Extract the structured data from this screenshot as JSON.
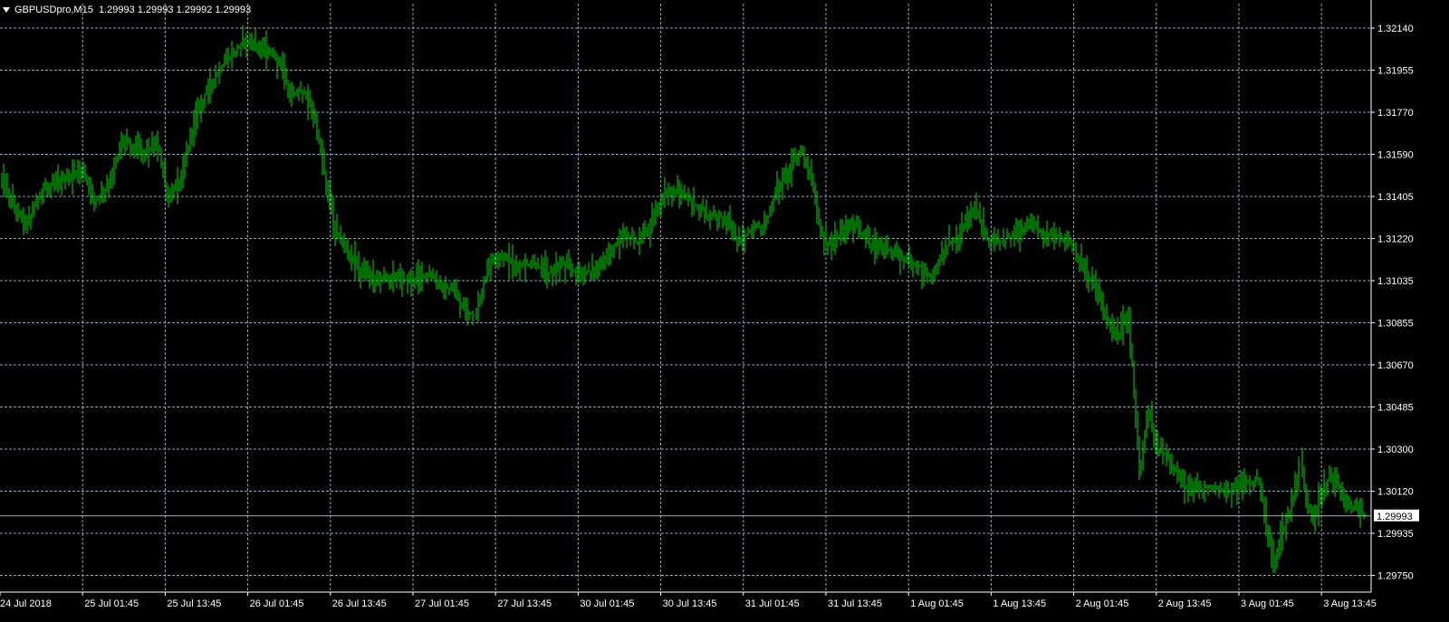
{
  "header": {
    "symbol": "GBPUSDpro,M15",
    "ohlc": "1.29993 1.29993 1.29992 1.29993"
  },
  "colors": {
    "background": "#000000",
    "grid": "#8aa4bd",
    "axis": "#ffffff",
    "bars": "#00dd00",
    "bid_line": "#9fb6cc",
    "text": "#ffffff"
  },
  "chart_data": {
    "type": "bar",
    "symbol": "GBPUSDpro",
    "timeframe": "M15",
    "y_ticks": [
      "1.32140",
      "1.31955",
      "1.31770",
      "1.31590",
      "1.31405",
      "1.31220",
      "1.31035",
      "1.30855",
      "1.30670",
      "1.30485",
      "1.30300",
      "1.30120",
      "1.29935",
      "1.29750"
    ],
    "x_ticks": [
      "24 Jul 2018",
      "25 Jul 01:45",
      "25 Jul 13:45",
      "26 Jul 01:45",
      "26 Jul 13:45",
      "27 Jul 01:45",
      "27 Jul 13:45",
      "30 Jul 01:45",
      "30 Jul 13:45",
      "31 Jul 01:45",
      "31 Jul 13:45",
      "1 Aug 01:45",
      "1 Aug 13:45",
      "2 Aug 01:45",
      "2 Aug 13:45",
      "3 Aug 01:45",
      "3 Aug 13:45"
    ],
    "current_price": "1.29993",
    "ylim": [
      1.297,
      1.3225
    ],
    "grid": true,
    "price_path": [
      [
        0,
        1.315
      ],
      [
        15,
        1.3135
      ],
      [
        30,
        1.3128
      ],
      [
        45,
        1.3142
      ],
      [
        70,
        1.3147
      ],
      [
        90,
        1.3152
      ],
      [
        105,
        1.3138
      ],
      [
        120,
        1.3145
      ],
      [
        135,
        1.3165
      ],
      [
        155,
        1.316
      ],
      [
        175,
        1.3162
      ],
      [
        185,
        1.3138
      ],
      [
        200,
        1.3148
      ],
      [
        215,
        1.3175
      ],
      [
        230,
        1.3188
      ],
      [
        245,
        1.3197
      ],
      [
        260,
        1.3204
      ],
      [
        270,
        1.3209
      ],
      [
        290,
        1.3205
      ],
      [
        310,
        1.3199
      ],
      [
        320,
        1.3183
      ],
      [
        335,
        1.3187
      ],
      [
        348,
        1.3173
      ],
      [
        360,
        1.3146
      ],
      [
        370,
        1.3125
      ],
      [
        380,
        1.3118
      ],
      [
        395,
        1.3109
      ],
      [
        410,
        1.3104
      ],
      [
        430,
        1.3105
      ],
      [
        450,
        1.3103
      ],
      [
        470,
        1.3106
      ],
      [
        490,
        1.31
      ],
      [
        500,
        1.3098
      ],
      [
        510,
        1.3091
      ],
      [
        525,
        1.3087
      ],
      [
        540,
        1.3111
      ],
      [
        555,
        1.3114
      ],
      [
        570,
        1.3109
      ],
      [
        590,
        1.311
      ],
      [
        605,
        1.3106
      ],
      [
        620,
        1.311
      ],
      [
        640,
        1.3106
      ],
      [
        660,
        1.3108
      ],
      [
        675,
        1.3116
      ],
      [
        690,
        1.3123
      ],
      [
        705,
        1.3119
      ],
      [
        720,
        1.3129
      ],
      [
        735,
        1.3142
      ],
      [
        750,
        1.3141
      ],
      [
        765,
        1.3137
      ],
      [
        780,
        1.3132
      ],
      [
        800,
        1.3131
      ],
      [
        815,
        1.312
      ],
      [
        830,
        1.3125
      ],
      [
        845,
        1.3128
      ],
      [
        860,
        1.3145
      ],
      [
        875,
        1.3155
      ],
      [
        885,
        1.316
      ],
      [
        895,
        1.3149
      ],
      [
        905,
        1.3125
      ],
      [
        915,
        1.3118
      ],
      [
        930,
        1.3125
      ],
      [
        945,
        1.3127
      ],
      [
        960,
        1.3119
      ],
      [
        980,
        1.3117
      ],
      [
        1000,
        1.3112
      ],
      [
        1015,
        1.3109
      ],
      [
        1030,
        1.3104
      ],
      [
        1045,
        1.3118
      ],
      [
        1060,
        1.3124
      ],
      [
        1075,
        1.3135
      ],
      [
        1090,
        1.3121
      ],
      [
        1105,
        1.312
      ],
      [
        1120,
        1.3123
      ],
      [
        1135,
        1.3127
      ],
      [
        1150,
        1.3125
      ],
      [
        1165,
        1.3122
      ],
      [
        1180,
        1.3121
      ],
      [
        1195,
        1.3108
      ],
      [
        1210,
        1.31
      ],
      [
        1222,
        1.3086
      ],
      [
        1235,
        1.3078
      ],
      [
        1245,
        1.309
      ],
      [
        1252,
        1.3055
      ],
      [
        1258,
        1.3018
      ],
      [
        1268,
        1.3045
      ],
      [
        1278,
        1.3028
      ],
      [
        1290,
        1.3025
      ],
      [
        1305,
        1.3013
      ],
      [
        1320,
        1.3011
      ],
      [
        1340,
        1.3012
      ],
      [
        1360,
        1.301
      ],
      [
        1375,
        1.3014
      ],
      [
        1390,
        1.3015
      ],
      [
        1400,
        1.299
      ],
      [
        1407,
        1.2978
      ],
      [
        1415,
        1.2992
      ],
      [
        1425,
        1.3002
      ],
      [
        1435,
        1.3024
      ],
      [
        1443,
        1.3005
      ],
      [
        1450,
        1.2998
      ],
      [
        1460,
        1.3011
      ],
      [
        1470,
        1.3018
      ],
      [
        1485,
        1.3006
      ],
      [
        1500,
        1.3001
      ],
      [
        1508,
        1.2999
      ]
    ]
  }
}
